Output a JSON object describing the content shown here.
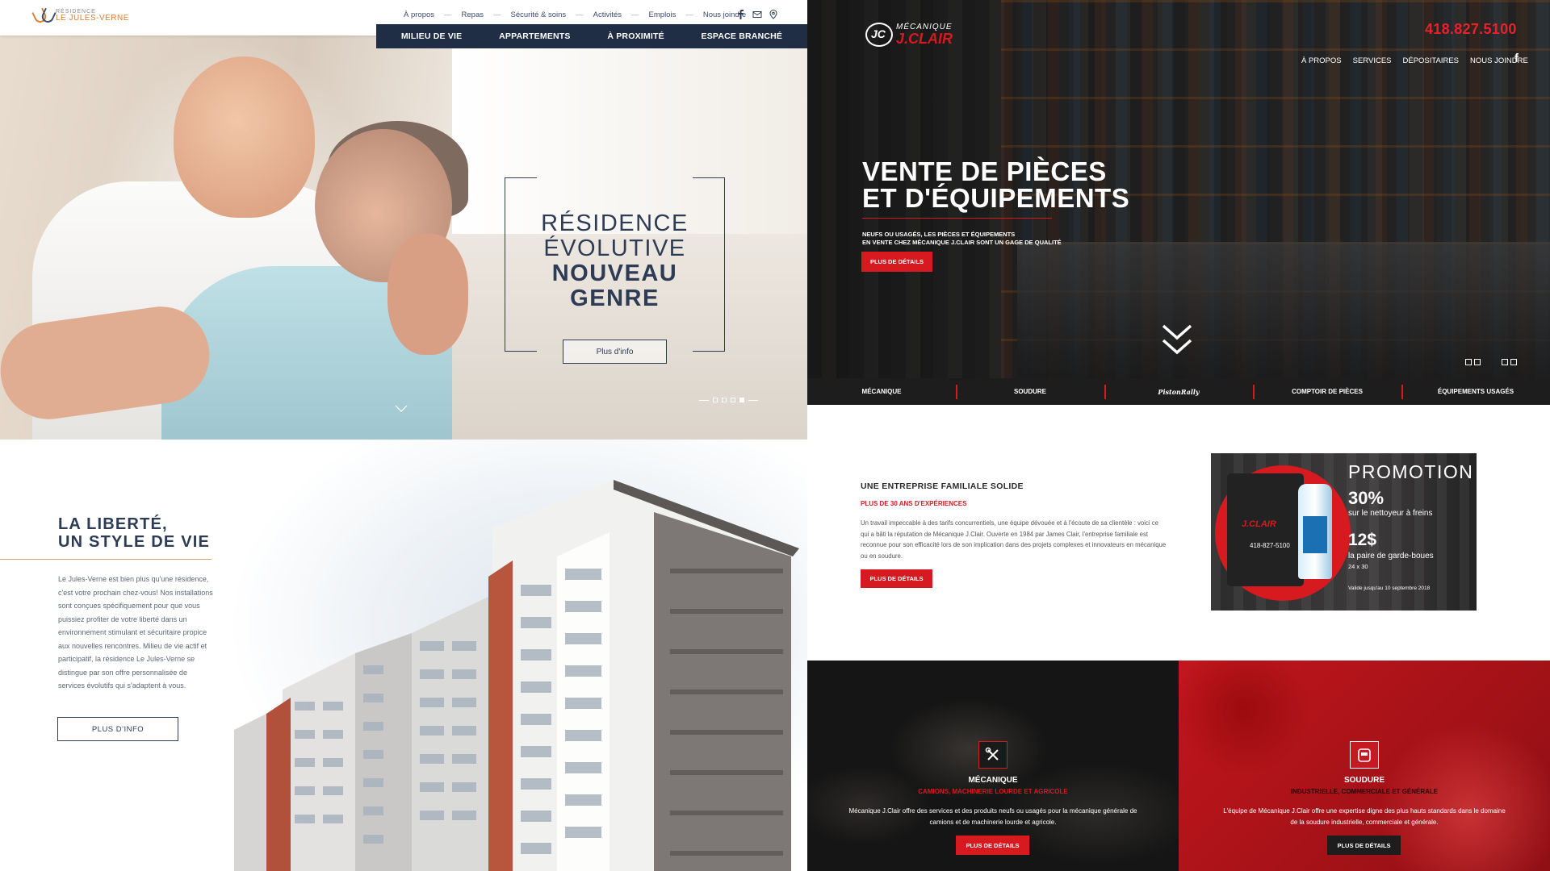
{
  "residence_hero": {
    "logo_sub": "RÉSIDENCE",
    "logo_name": "LE JULES-VERNE",
    "utility_nav": [
      "À propos",
      "Repas",
      "Sécurité & soins",
      "Activités",
      "Emplois",
      "Nous joindre"
    ],
    "social_icons": [
      "facebook-icon",
      "mail-icon",
      "location-pin-icon"
    ],
    "main_nav": [
      "MILIEU DE VIE",
      "APPARTEMENTS",
      "À PROXIMITÉ",
      "ESPACE BRANCHÉ"
    ],
    "title_line1": "RÉSIDENCE",
    "title_line2": "ÉVOLUTIVE",
    "title_line3": "NOUVEAU",
    "title_line4": "GENRE",
    "button": "Plus d'info",
    "slides_total": 4,
    "slide_active": 4,
    "colors": {
      "navy": "#1f2e45",
      "accent": "#e07a2f"
    }
  },
  "residence_section": {
    "title_line1": "LA LIBERTÉ,",
    "title_line2": "UN STYLE DE VIE",
    "body": "Le Jules-Verne est bien plus qu'une résidence, c'est votre prochain chez-vous! Nos installations sont conçues spécifiquement pour que vous puissiez profiter de votre liberté dans un environnement stimulant et sécuritaire propice aux nouvelles rencontres. Milieu de vie actif et participatif, la résidence Le Jules-Verne se distingue par son offre personnalisée de services évolutifs qui s'adaptent à vous.",
    "button": "PLUS D'INFO"
  },
  "clair_hero": {
    "logo_sub": "MÉCANIQUE",
    "logo_main": "J.CLAIR",
    "phone": "418.827.5100",
    "top_nav": [
      "À PROPOS",
      "SERVICES",
      "DÉPOSITAIRES",
      "NOUS JOINDRE"
    ],
    "facebook": "f",
    "headline_line1": "VENTE DE PIÈCES",
    "headline_line2": "ET D'ÉQUIPEMENTS",
    "sub_line1": "NEUFS OU USAGÉS, LES PIÈCES ET ÉQUIPEMENTS",
    "sub_line2": "EN VENTE CHEZ MÉCANIQUE J.CLAIR SONT UN GAGE DE QUALITÉ",
    "button": "PLUS DE DÉTAILS",
    "service_bar": [
      "MÉCANIQUE",
      "SOUDURE",
      "PistonRally",
      "COMPTOIR DE PIÈCES",
      "ÉQUIPEMENTS USAGÉS"
    ],
    "colors": {
      "red": "#d71920"
    }
  },
  "clair_about": {
    "kicker": "UNE ENTREPRISE FAMILIALE SOLIDE",
    "red_sub": "PLUS DE 30 ANS D'EXPÉRIENCES",
    "text": "Un travail impeccable à des tarifs concurrentiels, une équipe dévouée et à l'écoute de sa clientèle : voici ce qui a bâti la réputation de Mécanique J.Clair. Ouverte en 1984 par James Clair, l'entreprise familiale est reconnue pour son efficacité lors de son implication dans des projets complexes et innovateurs en mécanique ou en soudure.",
    "button": "PLUS DE DÉTAILS",
    "promo": {
      "title": "PROMOTION",
      "percent": "30%",
      "percent_label": "sur le nettoyeur à freins",
      "price": "12$",
      "price_label": "la paire de garde-boues",
      "price_size": "24 x 30",
      "validity": "Valide jusqu'au 10 septembre 2018",
      "bag_logo": "J.CLAIR",
      "bag_phone": "418-827-5100"
    }
  },
  "clair_mecanique": {
    "icon": "wrench-screwdriver-icon",
    "title": "MÉCANIQUE",
    "subtitle": "CAMIONS, MACHINERIE LOURDE ET AGRICOLE",
    "text": "Mécanique J.Clair offre des services et des produits neufs ou usagés pour la mécanique générale de camions et de machinerie lourde et agricole.",
    "button": "PLUS DE DÉTAILS"
  },
  "clair_soudure": {
    "icon": "welding-mask-icon",
    "title": "SOUDURE",
    "subtitle": "INDUSTRIELLE, COMMERCIALE ET GÉNÉRALE",
    "text": "L'équipe de Mécanique J.Clair offre une expertise digne des plus hauts standards dans le domaine de la soudure industrielle, commerciale et générale.",
    "button": "PLUS DE DÉTAILS"
  }
}
